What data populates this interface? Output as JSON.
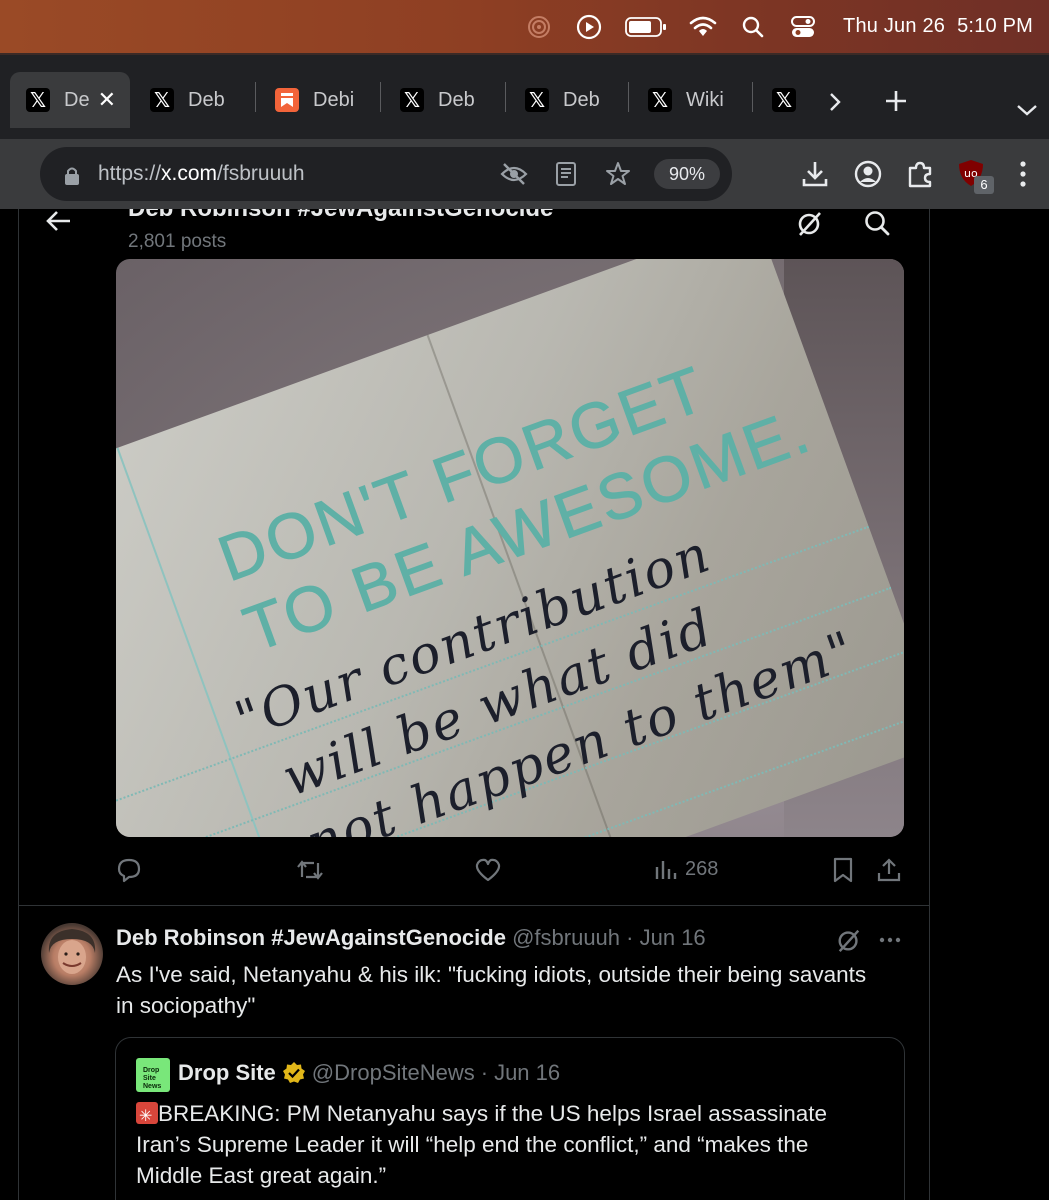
{
  "menubar": {
    "date": "Thu Jun 26",
    "time": "5:10 PM",
    "icons": [
      "screen-recorder-icon",
      "play-circle-icon",
      "battery-icon",
      "wifi-icon",
      "spotlight-search-icon",
      "control-center-icon"
    ]
  },
  "tabs": [
    {
      "label": "De",
      "favicon": "x-logo-icon",
      "active": true
    },
    {
      "label": "Deb",
      "favicon": "x-logo-icon"
    },
    {
      "label": "Debi",
      "favicon": "bookmark-app-icon"
    },
    {
      "label": "Deb",
      "favicon": "x-logo-icon"
    },
    {
      "label": "Deb",
      "favicon": "x-logo-icon"
    },
    {
      "label": "Wiki",
      "favicon": "x-logo-icon"
    },
    {
      "label": "",
      "favicon": "x-logo-icon"
    }
  ],
  "address": {
    "scheme": "https://",
    "host": "x.com",
    "path": "/fsbruuuh",
    "zoom": "90%",
    "extension_badge": "6"
  },
  "profile_header": {
    "name": "Deb Robinson #JewAgainstGenocide",
    "post_count": "2,801 posts"
  },
  "photo": {
    "print_line1": "DON'T FORGET",
    "print_line2": "TO BE AWESOME.",
    "hand_line1": "\"Our contribution",
    "hand_line2": "will be what did",
    "hand_line3": "not happen to them\""
  },
  "tweet1_actions": {
    "views": "268"
  },
  "tweet2": {
    "name": "Deb Robinson #JewAgainstGenocide",
    "handle": "@fsbruuuh",
    "date": "Jun 16",
    "text_line1": "As I've said, Netanyahu & his ilk: \"fucking idiots, outside their being savants",
    "text_line2": "in sociopathy\"",
    "quote": {
      "logo_text": "Drop Site News",
      "name": "Drop Site",
      "handle": "@DropSiteNews",
      "date": "Jun 16",
      "text": "BREAKING: PM Netanyahu says if the US helps Israel assassinate Iran’s Supreme Leader it will “help end the conflict,” and “makes the Middle East great again.”"
    }
  },
  "colors": {
    "accent_blue": "#1d9bf0",
    "verified_gold": "#e2b719",
    "muted": "#71767b",
    "menubar_brown": "#8e3f23"
  }
}
